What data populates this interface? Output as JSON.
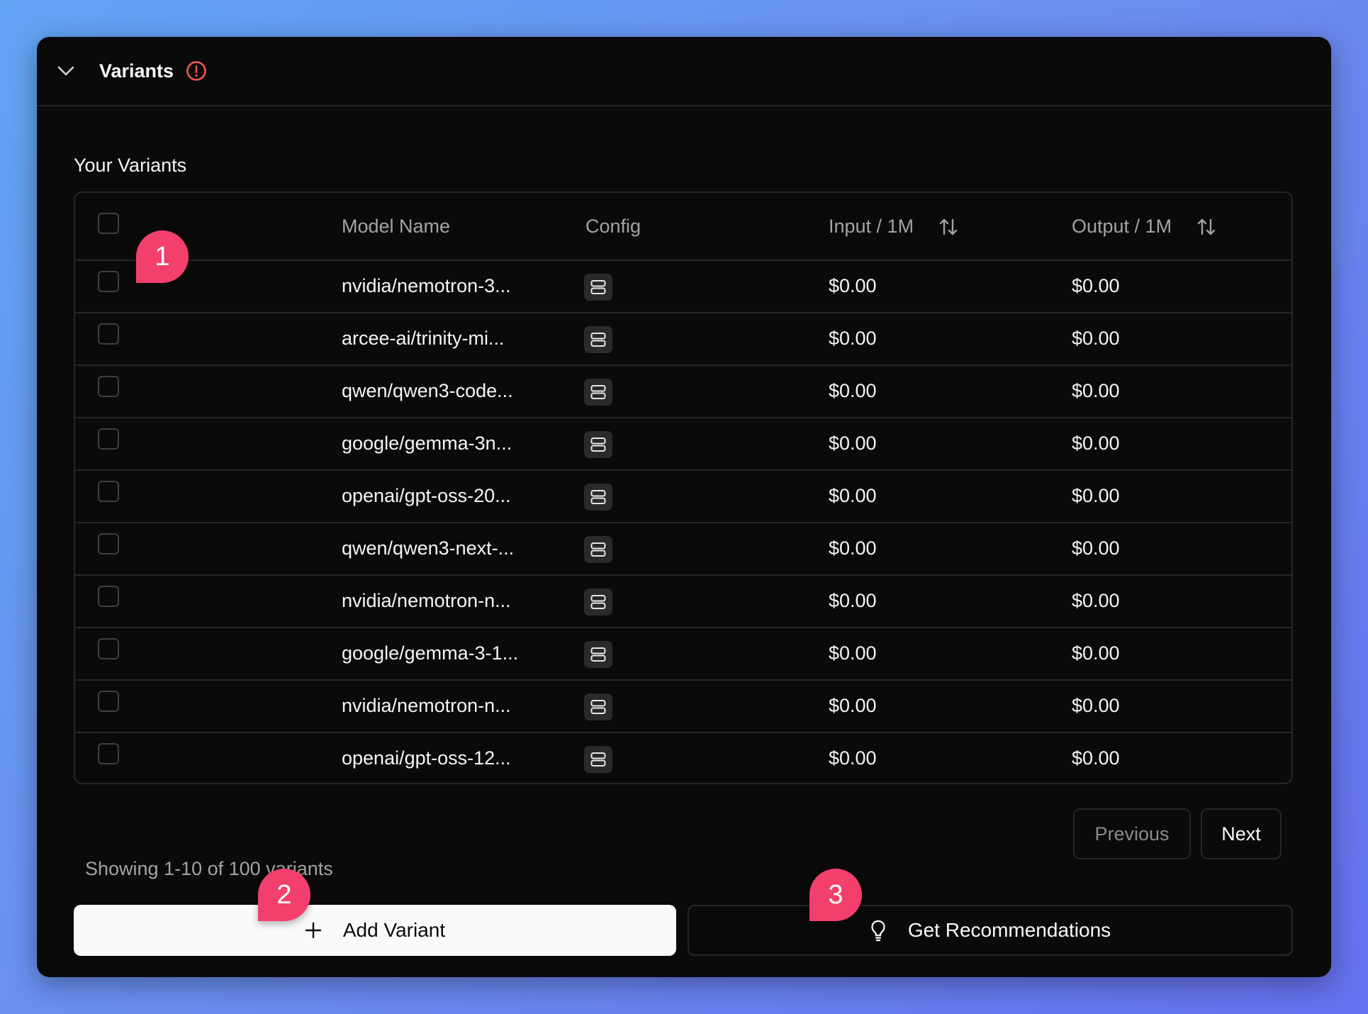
{
  "header": {
    "title": "Variants",
    "toggle_icon": "chevron-down-icon",
    "status_icon": "alert-circle-icon"
  },
  "section_title": "Your Variants",
  "table": {
    "columns": {
      "model": "Model Name",
      "config": "Config",
      "input": "Input / 1M",
      "output": "Output / 1M"
    },
    "rows": [
      {
        "model": "nvidia/nemotron-3...",
        "input": "$0.00",
        "output": "$0.00"
      },
      {
        "model": "arcee-ai/trinity-mi...",
        "input": "$0.00",
        "output": "$0.00"
      },
      {
        "model": "qwen/qwen3-code...",
        "input": "$0.00",
        "output": "$0.00"
      },
      {
        "model": "google/gemma-3n...",
        "input": "$0.00",
        "output": "$0.00"
      },
      {
        "model": "openai/gpt-oss-20...",
        "input": "$0.00",
        "output": "$0.00"
      },
      {
        "model": "qwen/qwen3-next-...",
        "input": "$0.00",
        "output": "$0.00"
      },
      {
        "model": "nvidia/nemotron-n...",
        "input": "$0.00",
        "output": "$0.00"
      },
      {
        "model": "google/gemma-3-1...",
        "input": "$0.00",
        "output": "$0.00"
      },
      {
        "model": "nvidia/nemotron-n...",
        "input": "$0.00",
        "output": "$0.00"
      },
      {
        "model": "openai/gpt-oss-12...",
        "input": "$0.00",
        "output": "$0.00"
      }
    ]
  },
  "footer": {
    "showing": "Showing 1-10 of 100 variants",
    "previous": "Previous",
    "next": "Next"
  },
  "actions": {
    "add_variant": "Add Variant",
    "get_recommendations": "Get Recommendations"
  },
  "callouts": [
    "1",
    "2",
    "3"
  ],
  "colors": {
    "accent": "#f33f6c",
    "panel": "#0a0a0a",
    "alert": "#ef5a4c"
  }
}
